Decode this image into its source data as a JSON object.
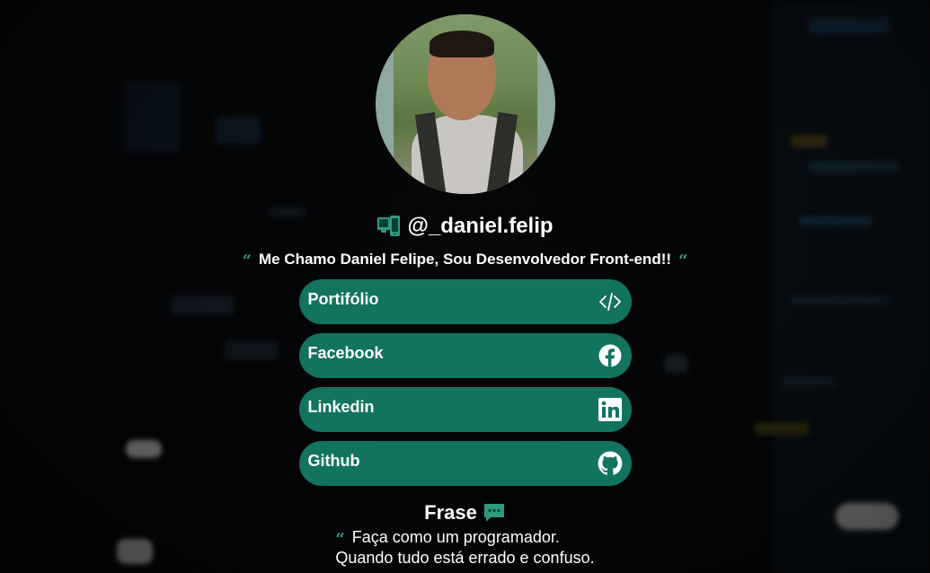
{
  "profile": {
    "handle": "@_daniel.felip",
    "bio": "Me Chamo Daniel Felipe, Sou Desenvolvedor Front-end!!"
  },
  "links": [
    {
      "label": "Portifólio",
      "icon": "code-icon"
    },
    {
      "label": "Facebook",
      "icon": "facebook-icon"
    },
    {
      "label": "Linkedin",
      "icon": "linkedin-icon"
    },
    {
      "label": "Github",
      "icon": "github-icon"
    }
  ],
  "quote_section": {
    "title": "Frase",
    "line1": "Faça como um programador.",
    "line2": "Quando tudo está errado e confuso."
  },
  "colors": {
    "accent": "#12735f",
    "quote_mark": "#2e9a80",
    "background": "#07090c"
  }
}
